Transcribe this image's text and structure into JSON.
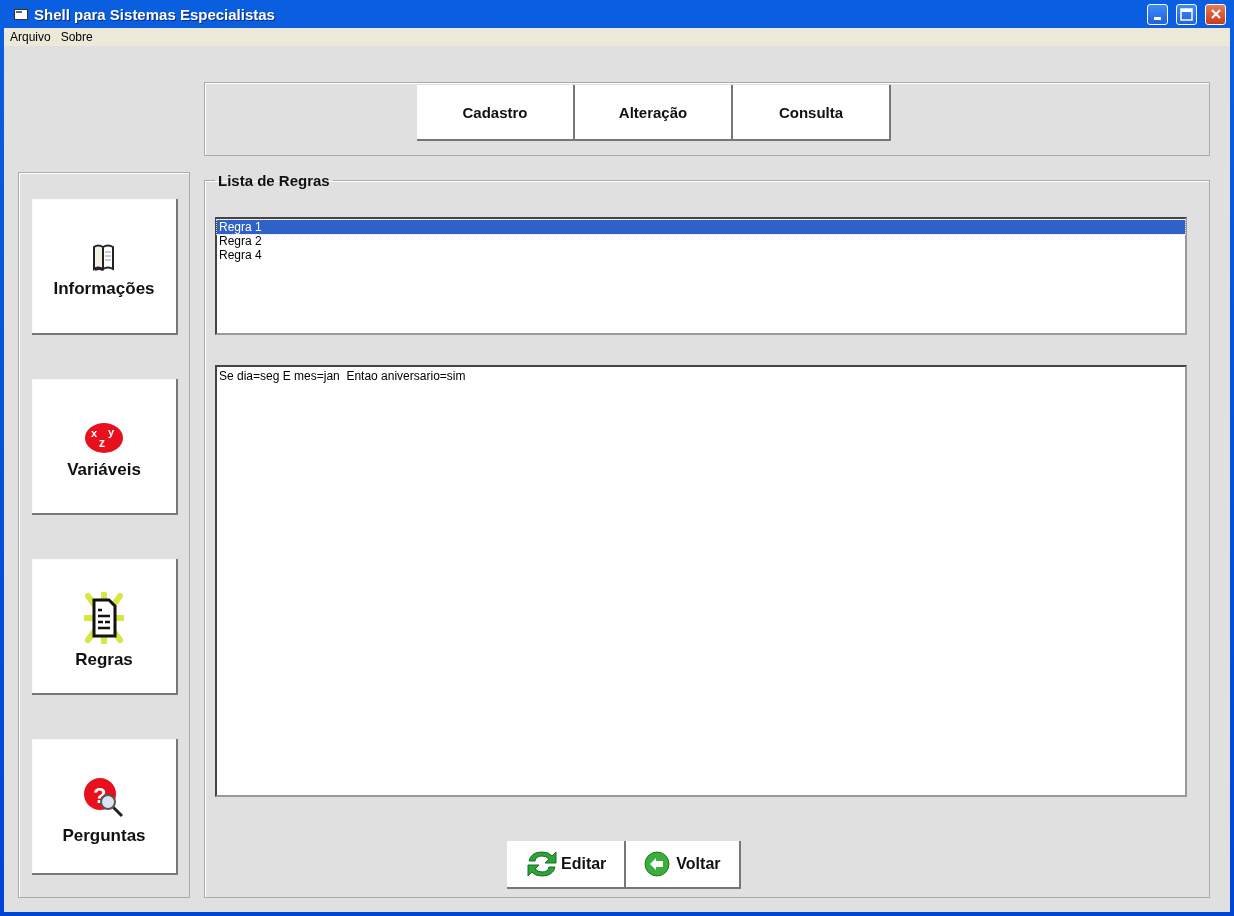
{
  "window": {
    "title": "Shell para Sistemas Especialistas"
  },
  "menu": [
    "Arquivo",
    "Sobre"
  ],
  "top_buttons": [
    {
      "label": "Cadastro"
    },
    {
      "label": "Alteração"
    },
    {
      "label": "Consulta"
    }
  ],
  "side_buttons": [
    {
      "label": "Informações",
      "kind": "book"
    },
    {
      "label": "Variáveis",
      "kind": "variables",
      "icon_letters": [
        "x",
        "z",
        "y"
      ]
    },
    {
      "label": "Regras",
      "kind": "document"
    },
    {
      "label": "Perguntas",
      "kind": "question",
      "icon_letters": [
        "?"
      ]
    }
  ],
  "rules_panel": {
    "title": "Lista de Regras",
    "rules": [
      {
        "label": "Regra 1",
        "selected": true
      },
      {
        "label": "Regra 2",
        "selected": false
      },
      {
        "label": "Regra 4",
        "selected": false
      }
    ],
    "rule_text": "Se dia=seg E mes=jan  Entao aniversario=sim"
  },
  "actions": [
    {
      "label": "Editar",
      "kind": "refresh"
    },
    {
      "label": "Voltar",
      "kind": "back"
    }
  ]
}
